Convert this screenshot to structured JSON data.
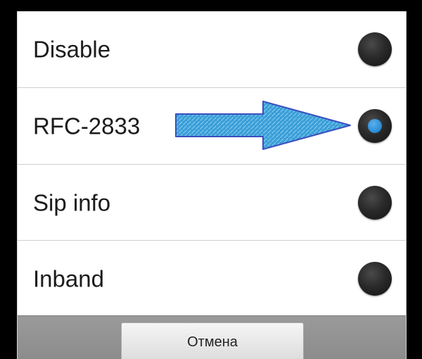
{
  "options": [
    {
      "label": "Disable",
      "selected": false
    },
    {
      "label": "RFC-2833",
      "selected": true
    },
    {
      "label": "Sip info",
      "selected": false
    },
    {
      "label": "Inband",
      "selected": false
    }
  ],
  "buttons": {
    "cancel_label": "Отмена"
  },
  "colors": {
    "radio_selected_dot": "#2e8fd8",
    "annotation_arrow_fill": "#3ba0d8",
    "annotation_arrow_stroke": "#3a4fbf",
    "button_bar": "#8c8c8c"
  },
  "icons": {
    "annotation": "right-arrow-icon"
  }
}
